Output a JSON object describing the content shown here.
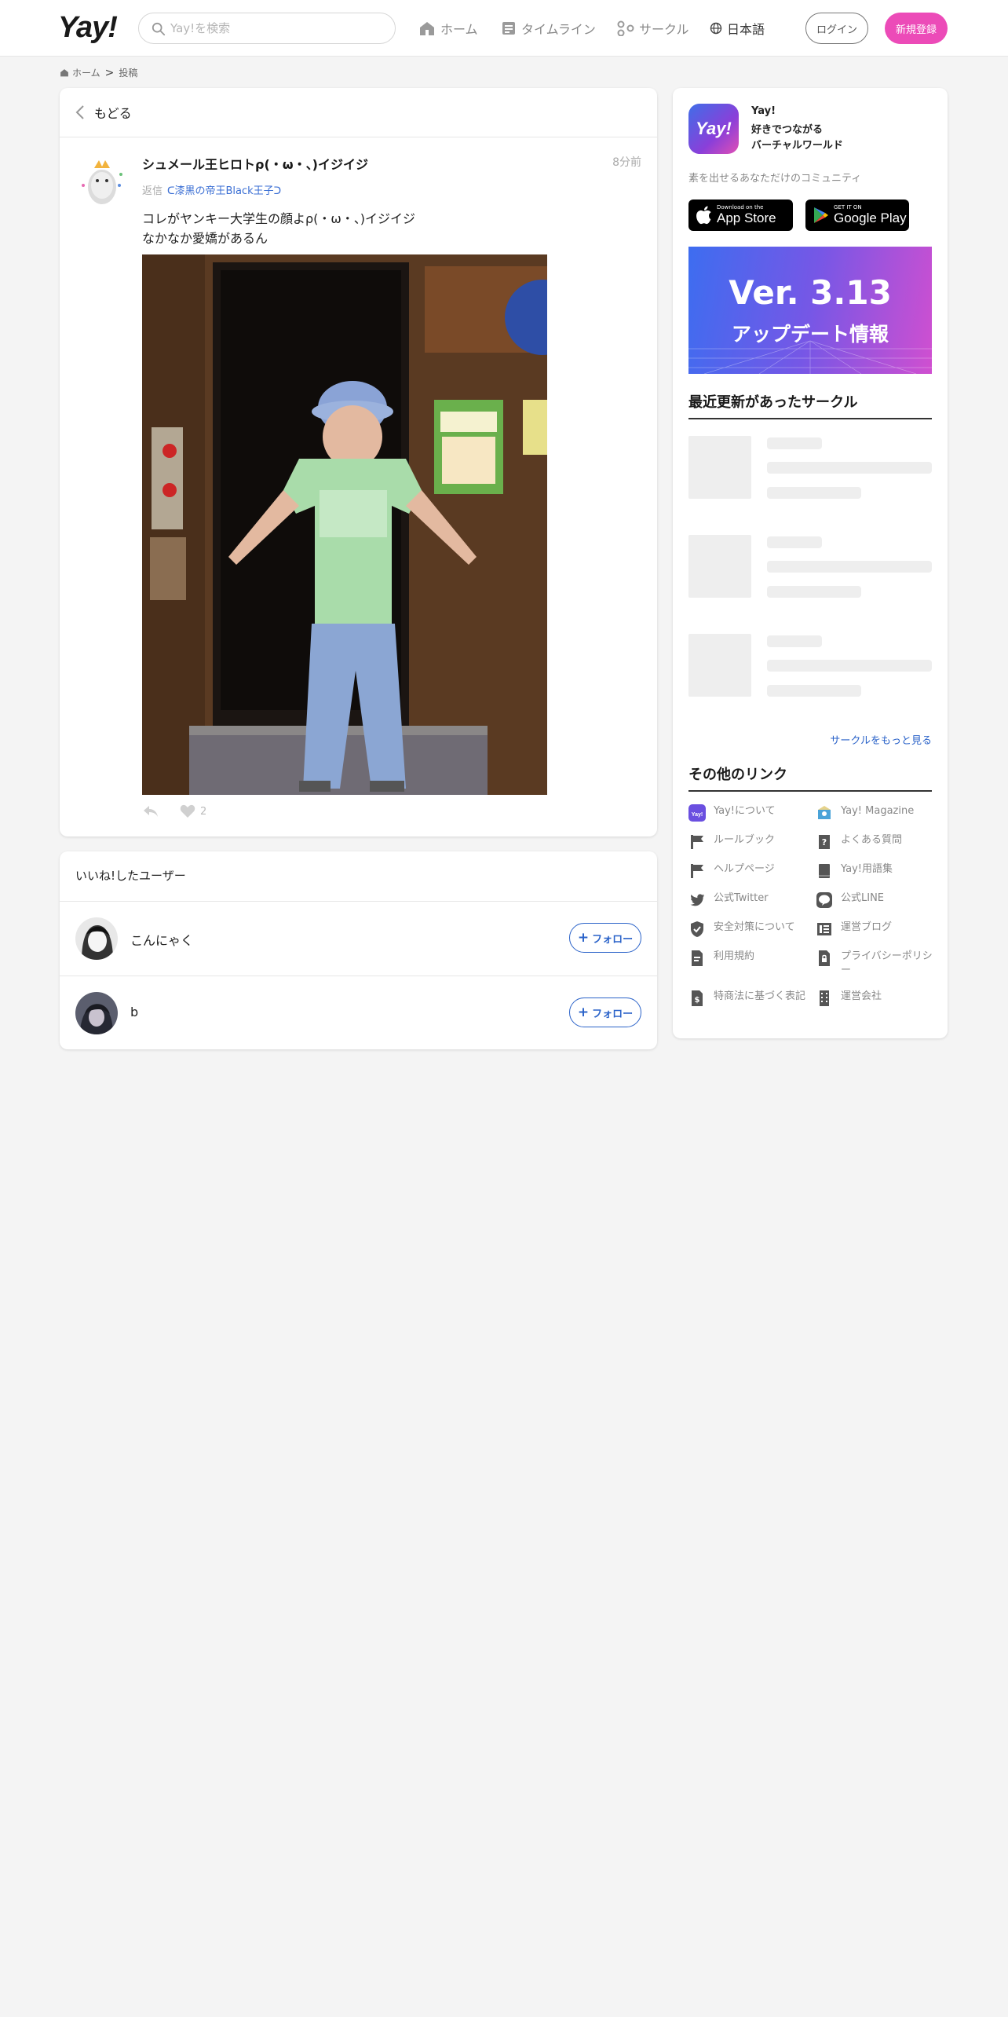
{
  "header": {
    "logo": "Yay!",
    "search_placeholder": "Yay!を検索",
    "nav": {
      "home": "ホーム",
      "timeline": "タイムライン",
      "circle": "サークル",
      "language": "日本語"
    },
    "login": "ログイン",
    "signup": "新規登録"
  },
  "breadcrumb": {
    "home": "ホーム",
    "separator": ">",
    "current": "投稿"
  },
  "post": {
    "back_label": "もどる",
    "author": "シュメール王ヒロトρ(・ω・、)イジイジ",
    "time": "8分前",
    "reply_prefix": "返信",
    "reply_to": "ᑕ漆黒の帝王Black王子ᑐ",
    "text": "コレがヤンキー大学生の顔よρ(・ω・、)イジイジ\nなかなか愛嬌があるん",
    "like_count": "2"
  },
  "likes": {
    "title": "いいね!したユーザー",
    "users": [
      {
        "name": "こんにゃく",
        "follow": "フォロー"
      },
      {
        "name": "b",
        "follow": "フォロー"
      }
    ]
  },
  "sidebar": {
    "app_icon_text": "Yay!",
    "app_name": "Yay!",
    "app_tagline": "好きでつながる\nバーチャルワールド",
    "app_desc": "素を出せるあなただけのコミュニティ",
    "app_store": {
      "small": "Download on the",
      "big": "App Store"
    },
    "google_play": {
      "small": "GET IT ON",
      "big": "Google Play"
    },
    "banner": {
      "line1": "Ver. 3.13",
      "line2": "アップデート情報"
    },
    "recent_circles_title": "最近更新があったサークル",
    "more_circles": "サークルをもっと見る",
    "other_links_title": "その他のリンク",
    "links": [
      {
        "label": "Yay!について",
        "icon": "yay-logo-icon"
      },
      {
        "label": "Yay! Magazine",
        "icon": "magazine-icon"
      },
      {
        "label": "ルールブック",
        "icon": "flag-icon"
      },
      {
        "label": "よくある質問",
        "icon": "question-icon"
      },
      {
        "label": "ヘルプページ",
        "icon": "flag-icon"
      },
      {
        "label": "Yay!用語集",
        "icon": "book-icon"
      },
      {
        "label": "公式Twitter",
        "icon": "twitter-icon"
      },
      {
        "label": "公式LINE",
        "icon": "line-icon"
      },
      {
        "label": "安全対策について",
        "icon": "shield-icon"
      },
      {
        "label": "運営ブログ",
        "icon": "blog-icon"
      },
      {
        "label": "利用規約",
        "icon": "document-icon"
      },
      {
        "label": "プライバシーポリシー",
        "icon": "privacy-icon"
      },
      {
        "label": "特商法に基づく表記",
        "icon": "dollar-doc-icon"
      },
      {
        "label": "運営会社",
        "icon": "building-icon"
      }
    ]
  }
}
